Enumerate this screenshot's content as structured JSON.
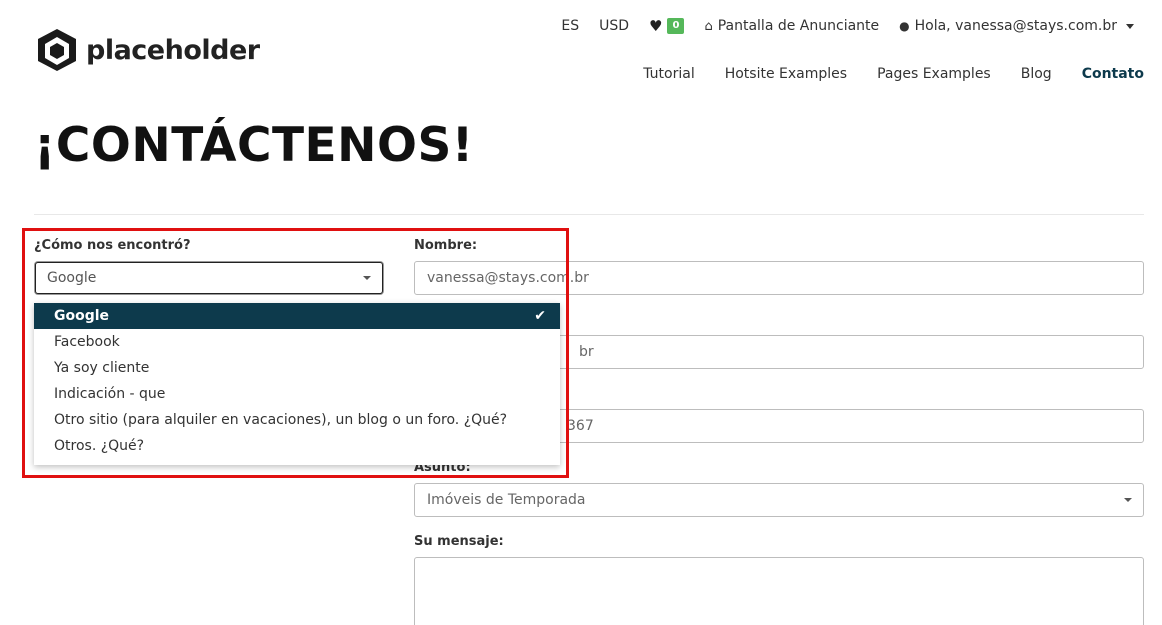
{
  "header": {
    "logo_text": "placeholder",
    "language": "ES",
    "currency": "USD",
    "favorites_count": "0",
    "advertiser_label": "Pantalla de Anunciante",
    "user_greeting": "Hola, vanessa@stays.com.br"
  },
  "nav": {
    "items": [
      {
        "label": "Tutorial"
      },
      {
        "label": "Hotsite Examples"
      },
      {
        "label": "Pages Examples"
      },
      {
        "label": "Blog"
      },
      {
        "label": "Contato"
      }
    ]
  },
  "page": {
    "title": "¡CONTÁCTENOS!"
  },
  "form": {
    "found_label": "¿Cómo nos encontró?",
    "found_value": "Google",
    "found_options": [
      "Google",
      "Facebook",
      "Ya soy cliente",
      "Indicación - que",
      "Otro sitio (para alquiler en vacaciones), un blog o un foro. ¿Qué?",
      "Otros. ¿Qué?"
    ],
    "name_label": "Nombre:",
    "name_value": "vanessa@stays.com.br",
    "email_value_partial": "br",
    "phone_value_partial": "367",
    "subject_label": "Asunto:",
    "subject_value": "Imóveis de Temporada",
    "message_label": "Su mensaje:"
  },
  "colors": {
    "accent": "#0d3a4c",
    "badge": "#55b85a",
    "highlight": "#e01010"
  }
}
